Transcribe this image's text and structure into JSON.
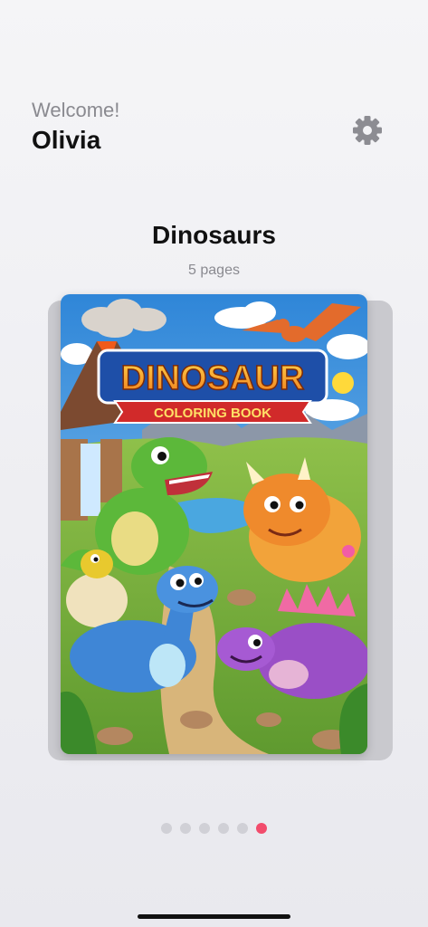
{
  "header": {
    "greeting": "Welcome!",
    "user_name": "Olivia",
    "settings_icon": "gear-icon"
  },
  "book": {
    "title": "Dinosaurs",
    "pages_label": "5 pages",
    "cover": {
      "headline": "DINOSAUR",
      "ribbon": "COLORING BOOK"
    }
  },
  "pager": {
    "count": 6,
    "active_index": 5,
    "active_color": "#f24c6c",
    "inactive_color": "#d0d0d6"
  },
  "colors": {
    "accent": "#f24c6c"
  }
}
